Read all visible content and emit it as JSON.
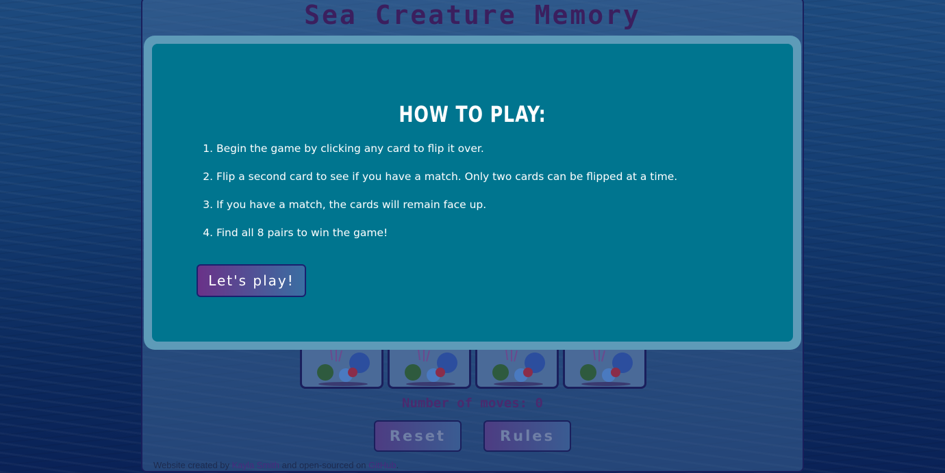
{
  "game": {
    "title": "Sea Creature Memory",
    "moves_label": "Number of moves: 0",
    "reset_label": "Reset",
    "rules_label": "Rules",
    "card_back_icon": "coral-reef-icon"
  },
  "footer": {
    "prefix": "Website created by ",
    "author": "Kayla Smith",
    "middle": " and open-sourced on ",
    "repo": "GitHub",
    "suffix": "."
  },
  "modal": {
    "title": "HOW TO PLAY:",
    "rules": [
      {
        "num": "1.",
        "text": "Begin the game by clicking any card to flip it over."
      },
      {
        "num": "2.",
        "text": "Flip a second card to see if you have a match. Only two cards can be flipped at a time."
      },
      {
        "num": "3.",
        "text": "If you have a match, the cards will remain face up."
      },
      {
        "num": "4.",
        "text": "Find all 8 pairs to win the game!"
      }
    ],
    "play_label": "Let's play!"
  },
  "colors": {
    "modal_bg": "#00758f",
    "modal_frame": "#5e9bb8",
    "button_gradient_start": "#6a3288",
    "button_gradient_end": "#3a6ea2"
  }
}
